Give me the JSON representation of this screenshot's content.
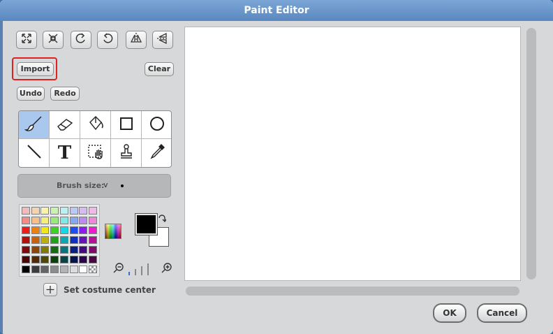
{
  "window": {
    "title": "Paint Editor"
  },
  "toolbar": {
    "icons": [
      "grow-icon",
      "shrink-icon",
      "rotate-ccw-icon",
      "rotate-cw-icon",
      "flip-horizontal-icon",
      "flip-vertical-icon"
    ]
  },
  "buttons": {
    "import": "Import",
    "clear": "Clear",
    "undo": "Undo",
    "redo": "Redo",
    "ok": "OK",
    "cancel": "Cancel"
  },
  "tools": {
    "selected": "brush",
    "items": [
      "brush-icon",
      "eraser-icon",
      "fill-icon",
      "rectangle-icon",
      "ellipse-icon",
      "line-icon",
      "text-icon",
      "select-icon",
      "stamp-icon",
      "eyedropper-icon"
    ],
    "text_glyph": "T"
  },
  "brush": {
    "label": "Brush size:",
    "chevron": "v"
  },
  "palette": {
    "rows": [
      [
        "#f4b9b9",
        "#f6d3b0",
        "#f7f3ad",
        "#c8f3b0",
        "#b8f2f0",
        "#b9c8f4",
        "#d8b9f2",
        "#f2b7e6"
      ],
      [
        "#f48a8a",
        "#f6c08a",
        "#f3ee7e",
        "#98ea7a",
        "#82e8e6",
        "#8aa6ef",
        "#bd8bee",
        "#ec88d6"
      ],
      [
        "#ee1c1c",
        "#f07f12",
        "#f0e90d",
        "#3ad324",
        "#12d9e9",
        "#1f4cf0",
        "#8a1cf0",
        "#ef1ccd"
      ],
      [
        "#b40f0f",
        "#c9620c",
        "#b9b00c",
        "#1fa11b",
        "#0ca6b3",
        "#0f2fc0",
        "#6512b8",
        "#b80f9b"
      ],
      [
        "#7d0b0b",
        "#8c4608",
        "#807b08",
        "#146c12",
        "#0a737b",
        "#0a1f82",
        "#450b7d",
        "#7e0b6b"
      ],
      [
        "#4a0606",
        "#522906",
        "#4c4905",
        "#0b400a",
        "#064447",
        "#06124c",
        "#29064a",
        "#4a0640"
      ],
      [
        "#000000",
        "#3b3b3b",
        "#646464",
        "#8c8c8c",
        "#b4b4b4",
        "#dcdcdc",
        "#ffffff",
        "checker"
      ]
    ]
  },
  "colors": {
    "primary": "#000000",
    "secondary": "#ffffff",
    "titlebar": "#6a96c8",
    "import_highlight": "#e02020"
  },
  "zoom": {
    "level": 1,
    "levels": 4
  },
  "costume_center": {
    "label": "Set costume center"
  }
}
